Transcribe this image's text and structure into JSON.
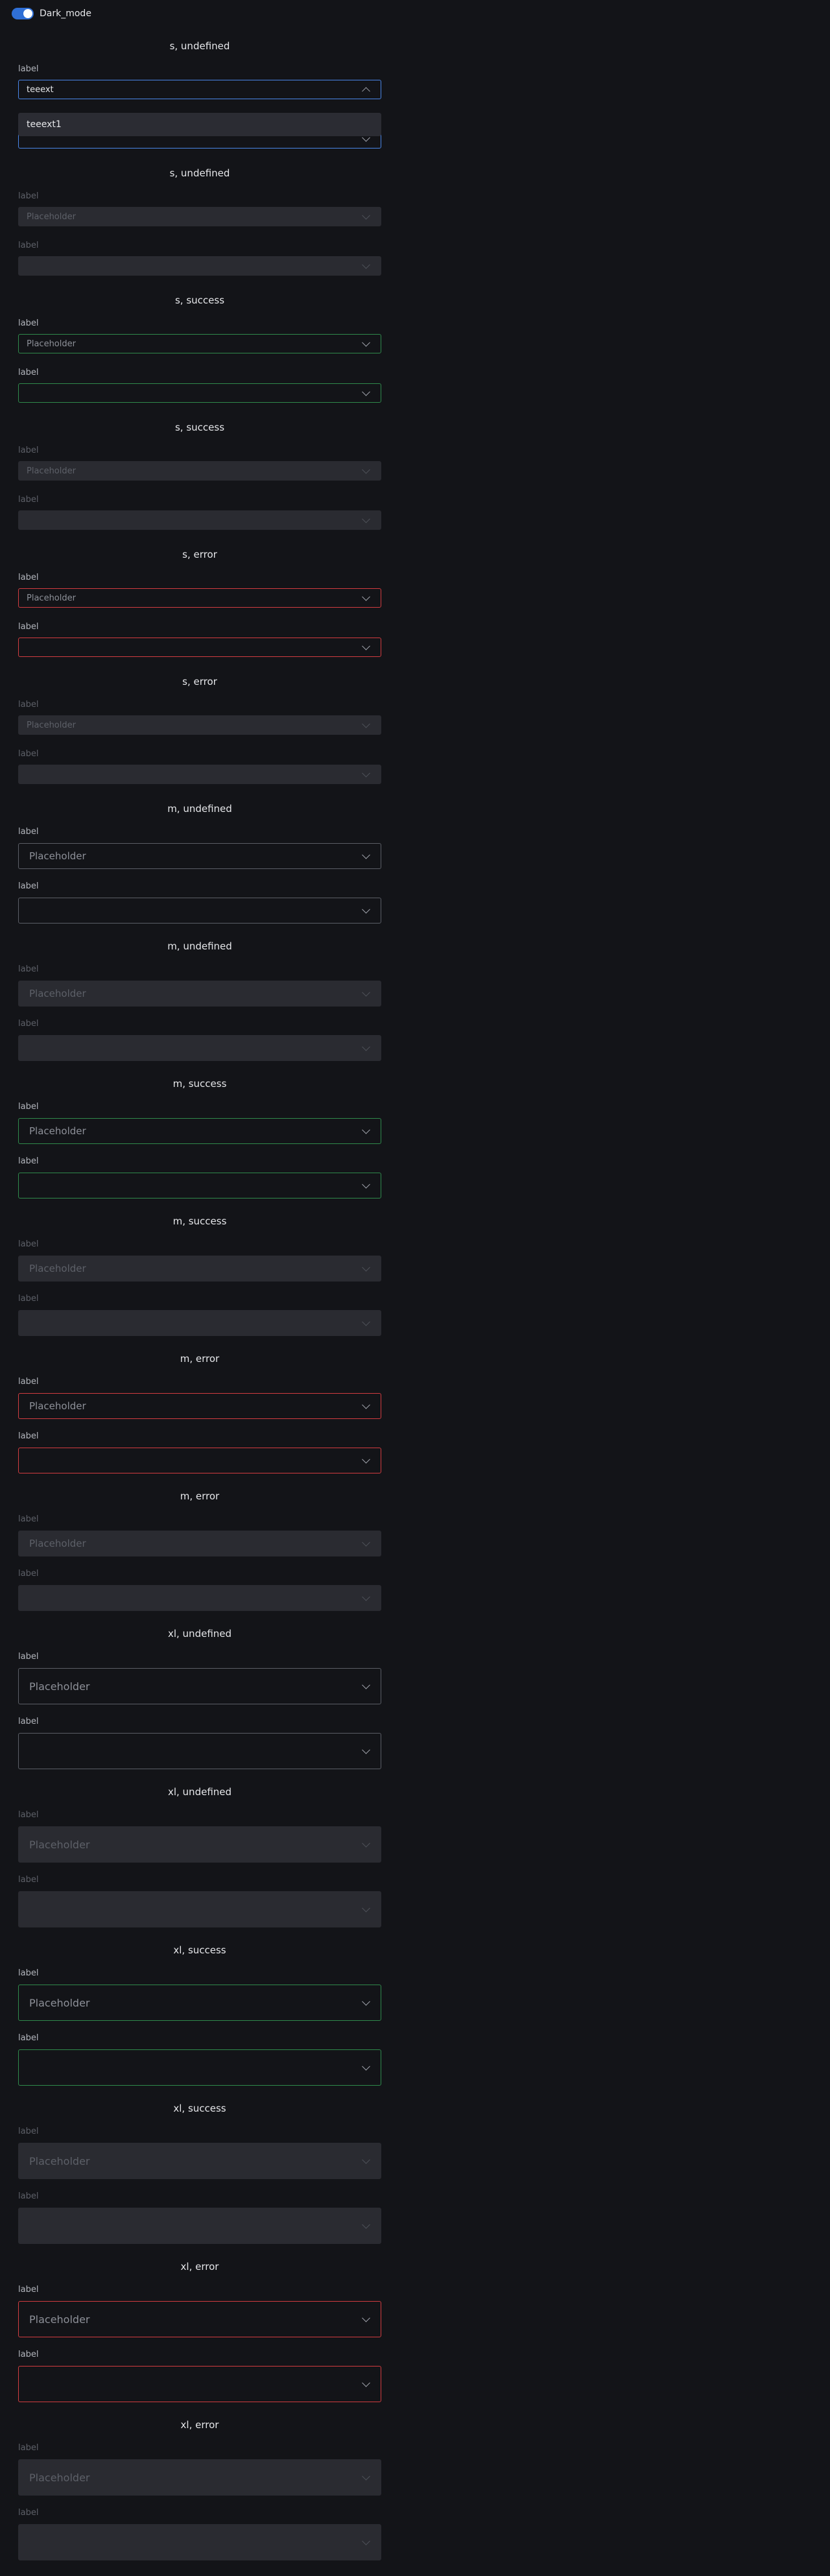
{
  "toggle": {
    "label": "Dark_mode",
    "on": true
  },
  "dropdown": {
    "option": "teeext1"
  },
  "sections": [
    {
      "title": "s, undefined",
      "size": "s",
      "status": "undefined",
      "disabled": false,
      "field1": {
        "label": "label",
        "value": "teeext",
        "placeholder": ""
      },
      "field2": {
        "label": "label"
      }
    },
    {
      "title": "s, undefined",
      "size": "s",
      "status": "undefined",
      "disabled": true,
      "field1": {
        "label": "label",
        "value": "",
        "placeholder": "Placeholder"
      },
      "field2": {
        "label": "label"
      }
    },
    {
      "title": "s, success",
      "size": "s",
      "status": "success",
      "disabled": false,
      "field1": {
        "label": "label",
        "value": "",
        "placeholder": "Placeholder"
      },
      "field2": {
        "label": "label"
      }
    },
    {
      "title": "s, success",
      "size": "s",
      "status": "success",
      "disabled": true,
      "field1": {
        "label": "label",
        "value": "",
        "placeholder": "Placeholder"
      },
      "field2": {
        "label": "label"
      }
    },
    {
      "title": "s, error",
      "size": "s",
      "status": "error",
      "disabled": false,
      "field1": {
        "label": "label",
        "value": "",
        "placeholder": "Placeholder"
      },
      "field2": {
        "label": "label"
      }
    },
    {
      "title": "s, error",
      "size": "s",
      "status": "error",
      "disabled": true,
      "field1": {
        "label": "label",
        "value": "",
        "placeholder": "Placeholder"
      },
      "field2": {
        "label": "label"
      }
    },
    {
      "title": "m, undefined",
      "size": "m",
      "status": "undefined",
      "disabled": false,
      "field1": {
        "label": "label",
        "value": "",
        "placeholder": "Placeholder"
      },
      "field2": {
        "label": "label"
      }
    },
    {
      "title": "m, undefined",
      "size": "m",
      "status": "undefined",
      "disabled": true,
      "field1": {
        "label": "label",
        "value": "",
        "placeholder": "Placeholder"
      },
      "field2": {
        "label": "label"
      }
    },
    {
      "title": "m, success",
      "size": "m",
      "status": "success",
      "disabled": false,
      "field1": {
        "label": "label",
        "value": "",
        "placeholder": "Placeholder"
      },
      "field2": {
        "label": "label"
      }
    },
    {
      "title": "m, success",
      "size": "m",
      "status": "success",
      "disabled": true,
      "field1": {
        "label": "label",
        "value": "",
        "placeholder": "Placeholder"
      },
      "field2": {
        "label": "label"
      }
    },
    {
      "title": "m, error",
      "size": "m",
      "status": "error",
      "disabled": false,
      "field1": {
        "label": "label",
        "value": "",
        "placeholder": "Placeholder"
      },
      "field2": {
        "label": "label"
      }
    },
    {
      "title": "m, error",
      "size": "m",
      "status": "error",
      "disabled": true,
      "field1": {
        "label": "label",
        "value": "",
        "placeholder": "Placeholder"
      },
      "field2": {
        "label": "label"
      }
    },
    {
      "title": "xl, undefined",
      "size": "xl",
      "status": "undefined",
      "disabled": false,
      "field1": {
        "label": "label",
        "value": "",
        "placeholder": "Placeholder"
      },
      "field2": {
        "label": "label"
      }
    },
    {
      "title": "xl, undefined",
      "size": "xl",
      "status": "undefined",
      "disabled": true,
      "field1": {
        "label": "label",
        "value": "",
        "placeholder": "Placeholder"
      },
      "field2": {
        "label": "label"
      }
    },
    {
      "title": "xl, success",
      "size": "xl",
      "status": "success",
      "disabled": false,
      "field1": {
        "label": "label",
        "value": "",
        "placeholder": "Placeholder"
      },
      "field2": {
        "label": "label"
      }
    },
    {
      "title": "xl, success",
      "size": "xl",
      "status": "success",
      "disabled": true,
      "field1": {
        "label": "label",
        "value": "",
        "placeholder": "Placeholder"
      },
      "field2": {
        "label": "label"
      }
    },
    {
      "title": "xl, error",
      "size": "xl",
      "status": "error",
      "disabled": false,
      "field1": {
        "label": "label",
        "value": "",
        "placeholder": "Placeholder"
      },
      "field2": {
        "label": "label"
      }
    },
    {
      "title": "xl, error",
      "size": "xl",
      "status": "error",
      "disabled": true,
      "field1": {
        "label": "label",
        "value": "",
        "placeholder": "Placeholder"
      },
      "field2": {
        "label": "label"
      }
    }
  ],
  "colors": {
    "background": "#131418",
    "accent": "#2f6fd6",
    "focus": "#4a86e8",
    "success": "#2f8a4b",
    "error": "#d13c40",
    "disabled_fill": "#2a2b31"
  },
  "icons": {
    "select_arrow": "chevron-down-icon",
    "open_arrow": "chevron-up-icon"
  }
}
